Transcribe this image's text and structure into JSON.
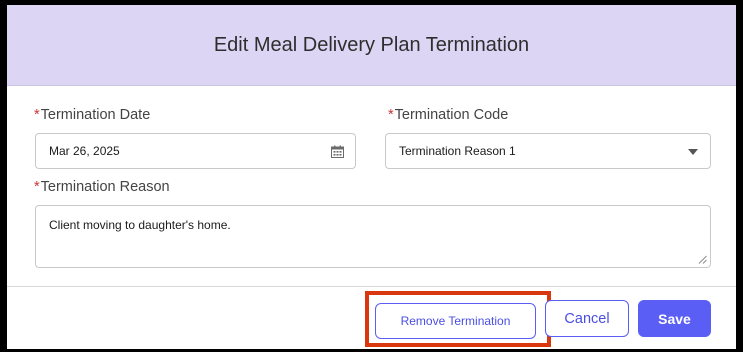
{
  "dialog": {
    "title": "Edit Meal Delivery Plan Termination"
  },
  "form": {
    "required_marker": "*",
    "termination_date": {
      "label": "Termination Date",
      "value": "Mar 26, 2025",
      "icon": "calendar-icon"
    },
    "termination_code": {
      "label": "Termination Code",
      "value": "Termination Reason 1",
      "icon": "chevron-down-icon"
    },
    "termination_reason": {
      "label": "Termination Reason",
      "value": "Client moving to daughter's home."
    }
  },
  "footer": {
    "remove_label": "Remove Termination",
    "cancel_label": "Cancel",
    "save_label": "Save"
  },
  "colors": {
    "header_bg": "#dcd6f4",
    "accent": "#5b5ef4",
    "required": "#c23934",
    "highlight_box": "#d9380f"
  }
}
